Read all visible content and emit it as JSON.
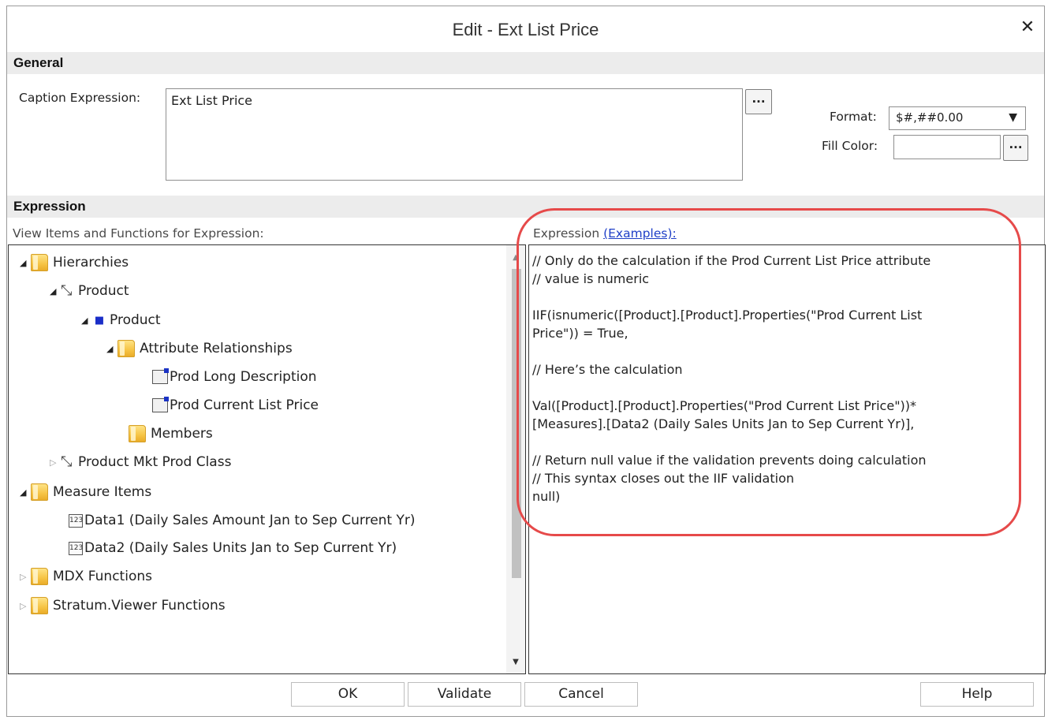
{
  "dialog": {
    "title": "Edit - Ext List Price"
  },
  "general": {
    "header": "General",
    "caption_label": "Caption Expression:",
    "caption_value": "Ext List Price",
    "caption_browse": "...",
    "format_label": "Format:",
    "format_value": "$#,##0.00",
    "fill_color_label": "Fill Color:",
    "fill_color_value": "",
    "fill_browse": "..."
  },
  "expression": {
    "header": "Expression",
    "left_label": "View Items and Functions for Expression:",
    "right_label": "Expression",
    "examples_link": "(Examples):",
    "code": "// Only do the calculation if the Prod Current List Price attribute\n// value is numeric\n\nIIF(isnumeric([Product].[Product].Properties(\"Prod Current List\nPrice\")) = True,\n\n// Here’s the calculation\n\nVal([Product].[Product].Properties(\"Prod Current List Price\"))*\n[Measures].[Data2 (Daily Sales Units Jan to Sep Current Yr)],\n\n// Return null value if the validation prevents doing calculation\n// This syntax closes out the IIF validation\nnull)"
  },
  "tree": [
    {
      "label": "Hierarchies"
    },
    {
      "label": "Product"
    },
    {
      "label": "Product"
    },
    {
      "label": "Attribute Relationships"
    },
    {
      "label": "Prod Long Description"
    },
    {
      "label": "Prod Current List Price"
    },
    {
      "label": "Members"
    },
    {
      "label": "Product Mkt Prod Class"
    },
    {
      "label": "Measure Items"
    },
    {
      "label": "Data1 (Daily Sales Amount Jan to Sep Current Yr)"
    },
    {
      "label": "Data2 (Daily Sales Units Jan to Sep Current Yr)"
    },
    {
      "label": "MDX Functions"
    },
    {
      "label": "Stratum.Viewer Functions"
    }
  ],
  "buttons": {
    "ok": "OK",
    "validate": "Validate",
    "cancel": "Cancel",
    "help": "Help"
  },
  "colors": {
    "highlight": "#e64a4a",
    "link": "#1f3fc7",
    "header_bg": "#ececec"
  }
}
